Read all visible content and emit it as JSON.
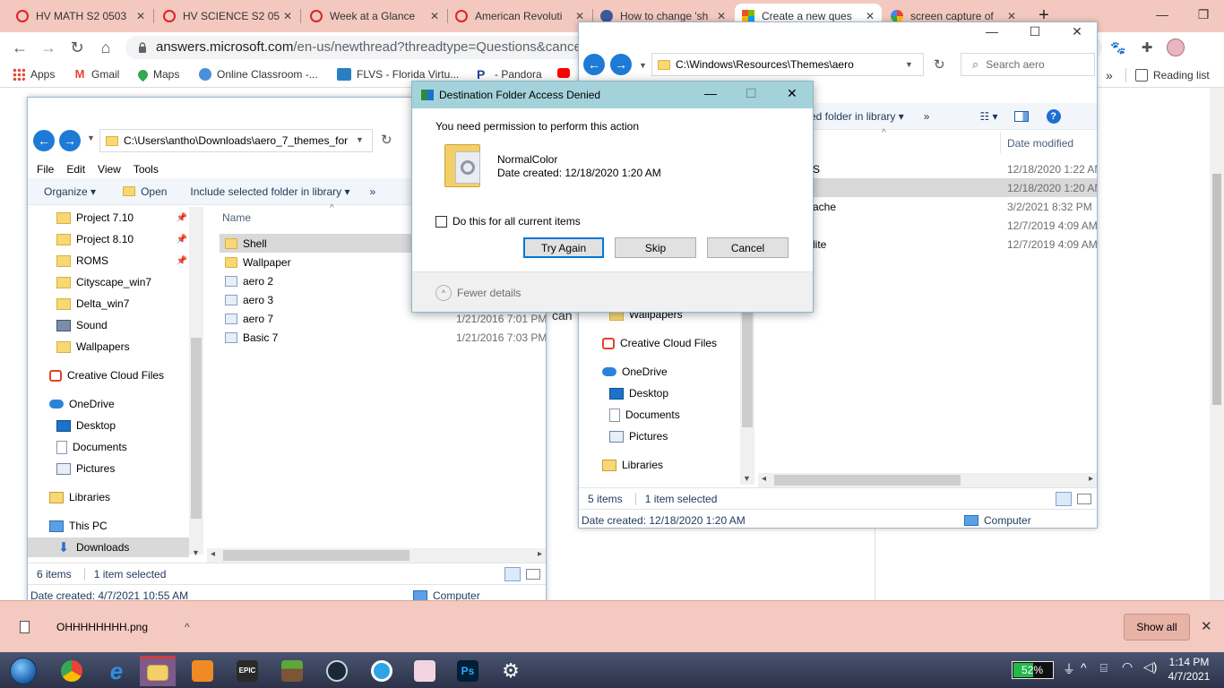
{
  "browser": {
    "tabs": [
      {
        "title": "HV MATH S2 0503",
        "favicon": "canvas-circle-icon",
        "active": false
      },
      {
        "title": "HV SCIENCE S2 05",
        "favicon": "canvas-circle-icon",
        "active": false
      },
      {
        "title": "Week at a Glance",
        "favicon": "canvas-circle-icon",
        "active": false
      },
      {
        "title": "American Revoluti",
        "favicon": "canvas-circle-icon",
        "active": false
      },
      {
        "title": "How to change 'sh",
        "favicon": "site-icon",
        "active": false
      },
      {
        "title": "Create a new ques",
        "favicon": "microsoft-icon",
        "active": true
      },
      {
        "title": "screen capture of",
        "favicon": "google-icon",
        "active": false
      }
    ],
    "url_host": "answers.microsoft.com",
    "url_path": "/en-us/newthread?threadtype=Questions&cancelurl=",
    "bookmarks": [
      {
        "label": "Apps"
      },
      {
        "label": "Gmail"
      },
      {
        "label": "Maps"
      },
      {
        "label": "Online Classroom -..."
      },
      {
        "label": "FLVS - Florida Virtu..."
      },
      {
        "label": "- Pandora"
      }
    ],
    "reading_list": "Reading list",
    "page_fragment": "can"
  },
  "explorer_left": {
    "address": "C:\\Users\\antho\\Downloads\\aero_7_themes_for",
    "menu": [
      "File",
      "Edit",
      "View",
      "Tools"
    ],
    "commands": {
      "organize": "Organize",
      "open": "Open",
      "include": "Include selected folder in library"
    },
    "nav": [
      {
        "label": "Project 7.10",
        "icon": "folder",
        "pinned": true
      },
      {
        "label": "Project 8.10",
        "icon": "folder",
        "pinned": true
      },
      {
        "label": "ROMS",
        "icon": "folder",
        "pinned": true
      },
      {
        "label": "Cityscape_win7",
        "icon": "folder"
      },
      {
        "label": "Delta_win7",
        "icon": "folder"
      },
      {
        "label": "Sound",
        "icon": "sound"
      },
      {
        "label": "Wallpapers",
        "icon": "folder"
      },
      {
        "label": "Creative Cloud Files",
        "icon": "cc"
      },
      {
        "label": "OneDrive",
        "icon": "cloud"
      },
      {
        "label": "Desktop",
        "icon": "desk"
      },
      {
        "label": "Documents",
        "icon": "doc"
      },
      {
        "label": "Pictures",
        "icon": "pic"
      },
      {
        "label": "Libraries",
        "icon": "lib"
      },
      {
        "label": "This PC",
        "icon": "pc"
      },
      {
        "label": "Downloads",
        "icon": "dl"
      }
    ],
    "column_name": "Name",
    "files": [
      {
        "name": "Shell",
        "date": "",
        "type": "folder",
        "selected": true
      },
      {
        "name": "Wallpaper",
        "date": "",
        "type": "folder"
      },
      {
        "name": "aero 2",
        "date": "",
        "type": "theme"
      },
      {
        "name": "aero 3",
        "date": "",
        "type": "theme"
      },
      {
        "name": "aero 7",
        "date": "1/21/2016 7:01 PM",
        "type": "theme"
      },
      {
        "name": "Basic 7",
        "date": "1/21/2016 7:03 PM",
        "type": "theme"
      }
    ],
    "status_items": "6 items",
    "status_selected": "1 item selected",
    "date_created": "Date created: 4/7/2021 10:55 AM",
    "computer": "Computer"
  },
  "explorer_right": {
    "address": "C:\\Windows\\Resources\\Themes\\aero",
    "search_placeholder": "Search aero",
    "include_fragment": "ed folder in library",
    "column_date": "Date modified",
    "rows": [
      {
        "name": "S",
        "date": "12/18/2020 1:22 AM"
      },
      {
        "name": "",
        "date": "12/18/2020 1:20 AM",
        "selected": true
      },
      {
        "name": "ache",
        "date": "3/2/2021 8:32 PM"
      },
      {
        "name": "",
        "date": "12/7/2019 4:09 AM"
      },
      {
        "name": "lite",
        "date": "12/7/2019 4:09 AM"
      }
    ],
    "nav": [
      {
        "label": "Wallpapers",
        "icon": "folder"
      },
      {
        "label": "Creative Cloud Files",
        "icon": "cc"
      },
      {
        "label": "OneDrive",
        "icon": "cloud"
      },
      {
        "label": "Desktop",
        "icon": "desk"
      },
      {
        "label": "Documents",
        "icon": "doc"
      },
      {
        "label": "Pictures",
        "icon": "pic"
      },
      {
        "label": "Libraries",
        "icon": "lib"
      }
    ],
    "status_items": "5 items",
    "status_selected": "1 item selected",
    "date_created": "Date created: 12/18/2020 1:20 AM",
    "computer": "Computer"
  },
  "dialog": {
    "title": "Destination Folder Access Denied",
    "message": "You need permission to perform this action",
    "item_name": "NormalColor",
    "item_date": "Date created: 12/18/2020 1:20 AM",
    "checkbox_label": "Do this for all current items",
    "buttons": {
      "try_again": "Try Again",
      "skip": "Skip",
      "cancel": "Cancel"
    },
    "fewer_details": "Fewer details"
  },
  "download_bar": {
    "file": "OHHHHHHHH.png",
    "show_all": "Show all"
  },
  "taskbar": {
    "battery": "52%",
    "time": "1:14 PM",
    "date": "4/7/2021"
  },
  "colors": {
    "chrome_frame": "#f3c9bf",
    "dialog_title": "#a3d2da",
    "accent_blue": "#1f7ad6"
  }
}
